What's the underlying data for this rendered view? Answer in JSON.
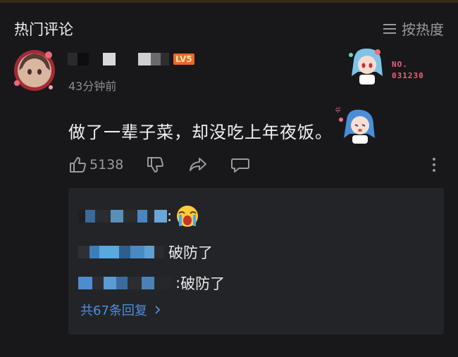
{
  "header": {
    "title": "热门评论",
    "sort_label": "按热度"
  },
  "comment": {
    "level_badge": "LV5",
    "time": "43分钟前",
    "badge_number_line1": "NO.",
    "badge_number_line2": "031230",
    "text": "做了一辈子菜，却没吃上年夜饭。",
    "like_count": "5138"
  },
  "replies": [
    {
      "separator": ":",
      "text": ""
    },
    {
      "separator": "",
      "text": "破防了"
    },
    {
      "separator": ":",
      "text": "破防了"
    }
  ],
  "more_replies": "共67条回复",
  "colors": {
    "background": "#18181a",
    "reply_bg": "#232427",
    "link": "#4d8fe0",
    "level": "#e86a2a",
    "badge": "#f0607a"
  }
}
